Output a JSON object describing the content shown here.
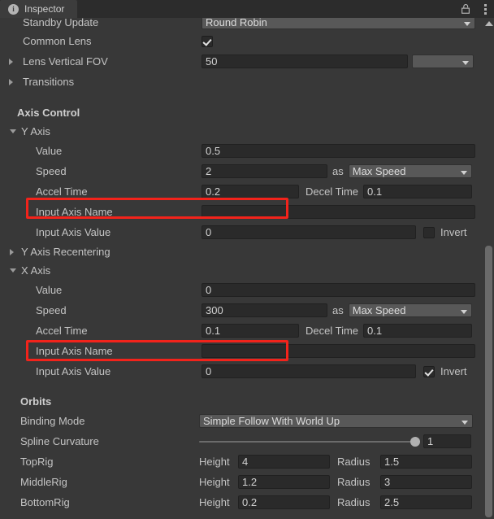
{
  "window": {
    "tab_label": "Inspector",
    "info_icon": "info-icon",
    "lock_icon": "lock-icon",
    "menu_icon": "kebab-menu-icon",
    "accent_red": "#f2231b",
    "background": "#383838"
  },
  "lens": {
    "standby_update_label": "Standby Update",
    "standby_update_value": "Round Robin",
    "common_lens_label": "Common Lens",
    "common_lens_checked": true,
    "lens_vertical_fov_label": "Lens Vertical FOV",
    "lens_vertical_fov_value": "50",
    "lens_fov_preset": "",
    "transitions_label": "Transitions"
  },
  "axis_control": {
    "header": "Axis Control",
    "y_axis": {
      "title": "Y Axis",
      "expanded": true,
      "value_label": "Value",
      "value": "0.5",
      "speed_label": "Speed",
      "speed": "2",
      "as_label": "as",
      "speed_mode": "Max Speed",
      "accel_time_label": "Accel Time",
      "accel_time": "0.2",
      "decel_time_label": "Decel Time",
      "decel_time": "0.1",
      "input_axis_name_label": "Input Axis Name",
      "input_axis_name": "",
      "input_axis_value_label": "Input Axis Value",
      "input_axis_value": "0",
      "invert_label": "Invert",
      "invert_checked": false
    },
    "y_axis_recentering": {
      "title": "Y Axis Recentering",
      "expanded": false
    },
    "x_axis": {
      "title": "X Axis",
      "expanded": true,
      "value_label": "Value",
      "value": "0",
      "speed_label": "Speed",
      "speed": "300",
      "as_label": "as",
      "speed_mode": "Max Speed",
      "accel_time_label": "Accel Time",
      "accel_time": "0.1",
      "decel_time_label": "Decel Time",
      "decel_time": "0.1",
      "input_axis_name_label": "Input Axis Name",
      "input_axis_name": "",
      "input_axis_value_label": "Input Axis Value",
      "input_axis_value": "0",
      "invert_label": "Invert",
      "invert_checked": true
    }
  },
  "orbits": {
    "header": "Orbits",
    "binding_mode_label": "Binding Mode",
    "binding_mode_value": "Simple Follow With World Up",
    "spline_curvature_label": "Spline Curvature",
    "spline_curvature_value": "1",
    "spline_curvature_percent": 100,
    "height_label": "Height",
    "radius_label": "Radius",
    "rigs": [
      {
        "name": "TopRig",
        "height": "4",
        "radius": "1.5"
      },
      {
        "name": "MiddleRig",
        "height": "1.2",
        "radius": "3"
      },
      {
        "name": "BottomRig",
        "height": "0.2",
        "radius": "2.5"
      }
    ]
  },
  "annotations": {
    "highlight_count": 2,
    "highlight_color": "#f2231b",
    "highlighted_fields": [
      "Input Axis Name",
      "Input Axis Name"
    ]
  }
}
